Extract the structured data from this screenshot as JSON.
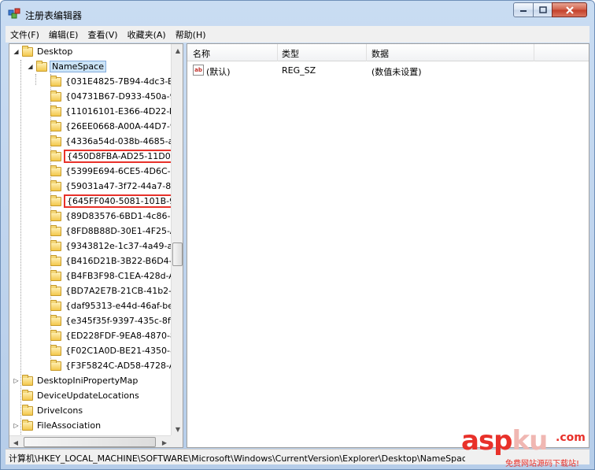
{
  "window": {
    "title": "注册表编辑器"
  },
  "menu": [
    "文件(F)",
    "编辑(E)",
    "查看(V)",
    "收藏夹(A)",
    "帮助(H)"
  ],
  "tree": {
    "desktop": "Desktop",
    "namespace": "NameSpace",
    "children": [
      "{031E4825-7B94-4dc3-B",
      "{04731B67-D933-450a-9",
      "{11016101-E366-4D22-B",
      "{26EE0668-A00A-44D7-9",
      "{4336a54d-038b-4685-a",
      "{450D8FBA-AD25-11D0-",
      "{5399E694-6CE5-4D6C-8",
      "{59031a47-3f72-44a7-89",
      "{645FF040-5081-101B-9F",
      "{89D83576-6BD1-4c86-9",
      "{8FD8B88D-30E1-4F25-A",
      "{9343812e-1c37-4a49-a",
      "{B416D21B-3B22-B6D4-",
      "{B4FB3F98-C1EA-428d-A",
      "{BD7A2E7B-21CB-41b2-",
      "{daf95313-e44d-46af-be",
      "{e345f35f-9397-435c-8f",
      "{ED228FDF-9EA8-4870-8",
      "{F02C1A0D-BE21-4350-8",
      "{F3F5824C-AD58-4728-A"
    ],
    "siblings": [
      "DesktopIniPropertyMap",
      "DeviceUpdateLocations",
      "DriveIcons",
      "FileAssociation"
    ]
  },
  "list": {
    "headers": {
      "name": "名称",
      "type": "类型",
      "data": "数据"
    },
    "rows": [
      {
        "icon": "ab",
        "name": "(默认)",
        "type": "REG_SZ",
        "data": "(数值未设置)"
      }
    ]
  },
  "status": {
    "path": "计算机\\HKEY_LOCAL_MACHINE\\SOFTWARE\\Microsoft\\Windows\\CurrentVersion\\Explorer\\Desktop\\NameSpace"
  },
  "watermark": {
    "brand_a": "asp",
    "brand_b": "ku",
    "domain": ".com",
    "slogan": "免费网站源码下载站!"
  },
  "colors": {
    "highlight": "#e8312a",
    "selection": "#cce4f7"
  }
}
